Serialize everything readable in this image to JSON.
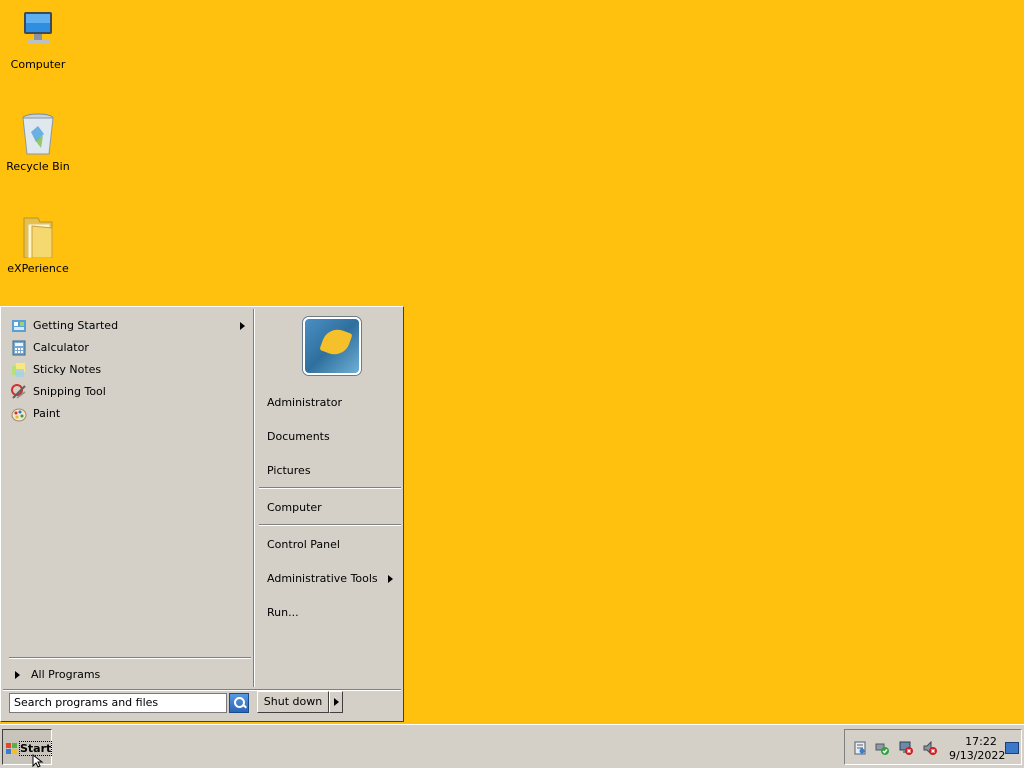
{
  "desktop": {
    "background": "#FFC10E",
    "icons": [
      {
        "label": "Computer",
        "icon": "computer-icon"
      },
      {
        "label": "Recycle Bin",
        "icon": "recycle-bin-icon"
      },
      {
        "label": "eXPerience",
        "icon": "folder-icon"
      }
    ]
  },
  "start_menu": {
    "programs": [
      {
        "label": "Getting Started",
        "icon": "getting-started-icon",
        "has_submenu": true
      },
      {
        "label": "Calculator",
        "icon": "calculator-icon"
      },
      {
        "label": "Sticky Notes",
        "icon": "sticky-notes-icon"
      },
      {
        "label": "Snipping Tool",
        "icon": "snipping-tool-icon"
      },
      {
        "label": "Paint",
        "icon": "paint-icon"
      }
    ],
    "all_programs": "All Programs",
    "user_picture": "user-avatar",
    "places": [
      {
        "label": "Administrator"
      },
      {
        "label": "Documents"
      },
      {
        "label": "Pictures"
      },
      {
        "label": "Computer"
      },
      {
        "label": "Control Panel"
      },
      {
        "label": "Administrative Tools",
        "has_submenu": true
      },
      {
        "label": "Run..."
      }
    ],
    "search_placeholder": "Search programs and files",
    "shutdown_label": "Shut down"
  },
  "taskbar": {
    "start_label": "Start",
    "clock_time": "17:22",
    "clock_date": "9/13/2022"
  }
}
